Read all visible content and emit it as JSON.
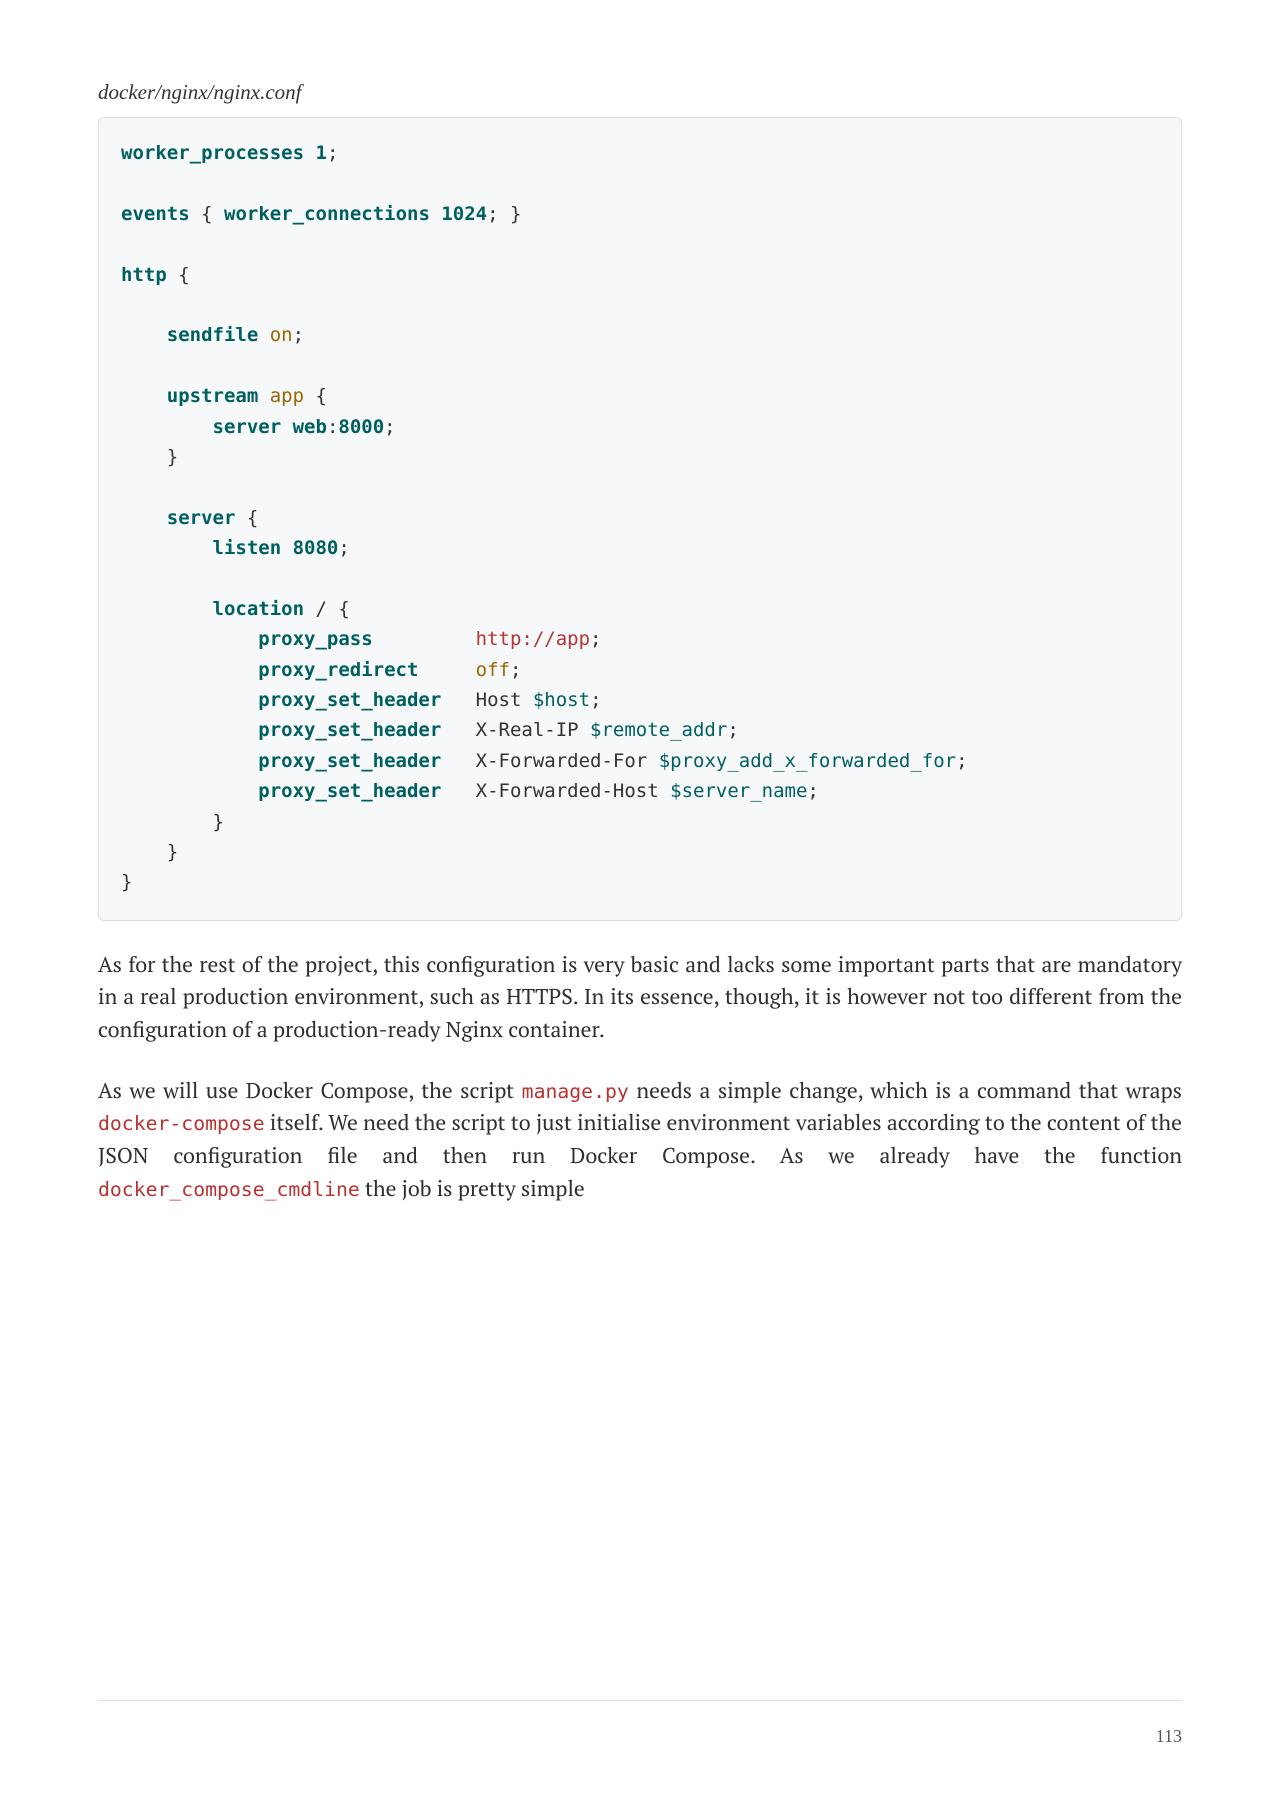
{
  "fileLabel": "docker/nginx/nginx.conf",
  "code": {
    "worker_processes": "worker_processes",
    "one": "1",
    "semi": ";",
    "events": "events",
    "lbrace": "{",
    "rbrace": "}",
    "worker_connections": "worker_connections",
    "n1024": "1024",
    "http": "http",
    "sendfile": "sendfile",
    "on": "on",
    "upstream": "upstream",
    "app": "app",
    "server_dir": "server",
    "web": "web",
    "colon": ":",
    "p8000": "8000",
    "server_block": "server",
    "listen": "listen",
    "p8080": "8080",
    "location": "location",
    "slash": "/",
    "proxy_pass": "proxy_pass",
    "http_app": "http://app",
    "proxy_redirect": "proxy_redirect",
    "off": "off",
    "proxy_set_header": "proxy_set_header",
    "Host": "Host",
    "dhost": "$host",
    "XRealIP": "X-Real-IP",
    "dremote": "$remote_addr",
    "XFF": "X-Forwarded-For",
    "dproxy": "$proxy_add_x_forwarded_for",
    "XFH": "X-Forwarded-Host",
    "dserver": "$server_name"
  },
  "para1a": "As for the rest of the project, this configuration is very basic and lacks some important parts that are mandatory in a real production environment, such as HTTPS. In its essence, though, it is however not too different from the configuration of a production-ready Nginx container.",
  "para2a": "As we will use Docker Compose, the script ",
  "managepy": "manage.py",
  "para2b": " needs a simple change, which is a command that wraps ",
  "dockercompose": "docker-compose",
  "para2c": " itself. We need the script to just initialise environment variables according to the content of the JSON configuration file and then run Docker Compose. As we already have the function ",
  "cmdline": "docker_compose_cmdline",
  "para2d": " the job is pretty simple",
  "pageNumber": "113"
}
